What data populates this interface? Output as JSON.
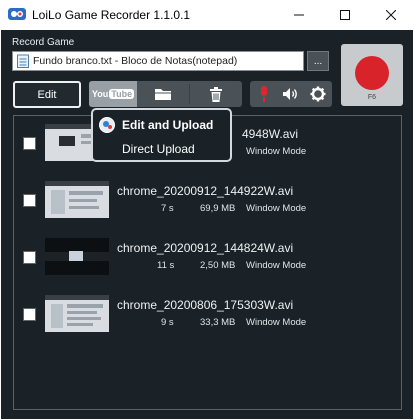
{
  "window": {
    "title": "LoiLo Game Recorder 1.1.0.1"
  },
  "record_game": {
    "label": "Record Game",
    "value": "Fundo branco.txt - Bloco de Notas(notepad)",
    "browse_label": "..."
  },
  "record_button": {
    "hotkey": "F6",
    "color": "#d8232a"
  },
  "toolbar": {
    "edit_label": "Edit",
    "youtube_label_you": "You",
    "youtube_label_tube": "Tube"
  },
  "upload_menu": {
    "items": [
      {
        "label": "Edit and Upload"
      },
      {
        "label": "Direct Upload"
      }
    ]
  },
  "recordings": [
    {
      "filename_visible": "4948W.avi",
      "duration": "",
      "size": "",
      "mode": "Window Mode"
    },
    {
      "filename_visible": "chrome_20200912_144922W.avi",
      "duration": "7 s",
      "size": "69,9 MB",
      "mode": "Window Mode"
    },
    {
      "filename_visible": "chrome_20200912_144824W.avi",
      "duration": "11 s",
      "size": "2,50 MB",
      "mode": "Window Mode"
    },
    {
      "filename_visible": "chrome_20200806_175303W.avi",
      "duration": "9 s",
      "size": "33,3 MB",
      "mode": "Window Mode"
    }
  ],
  "colors": {
    "background": "#1b2227",
    "tool_group": "#4a5258",
    "record_red": "#d8232a",
    "mic_red": "#e0262d"
  }
}
